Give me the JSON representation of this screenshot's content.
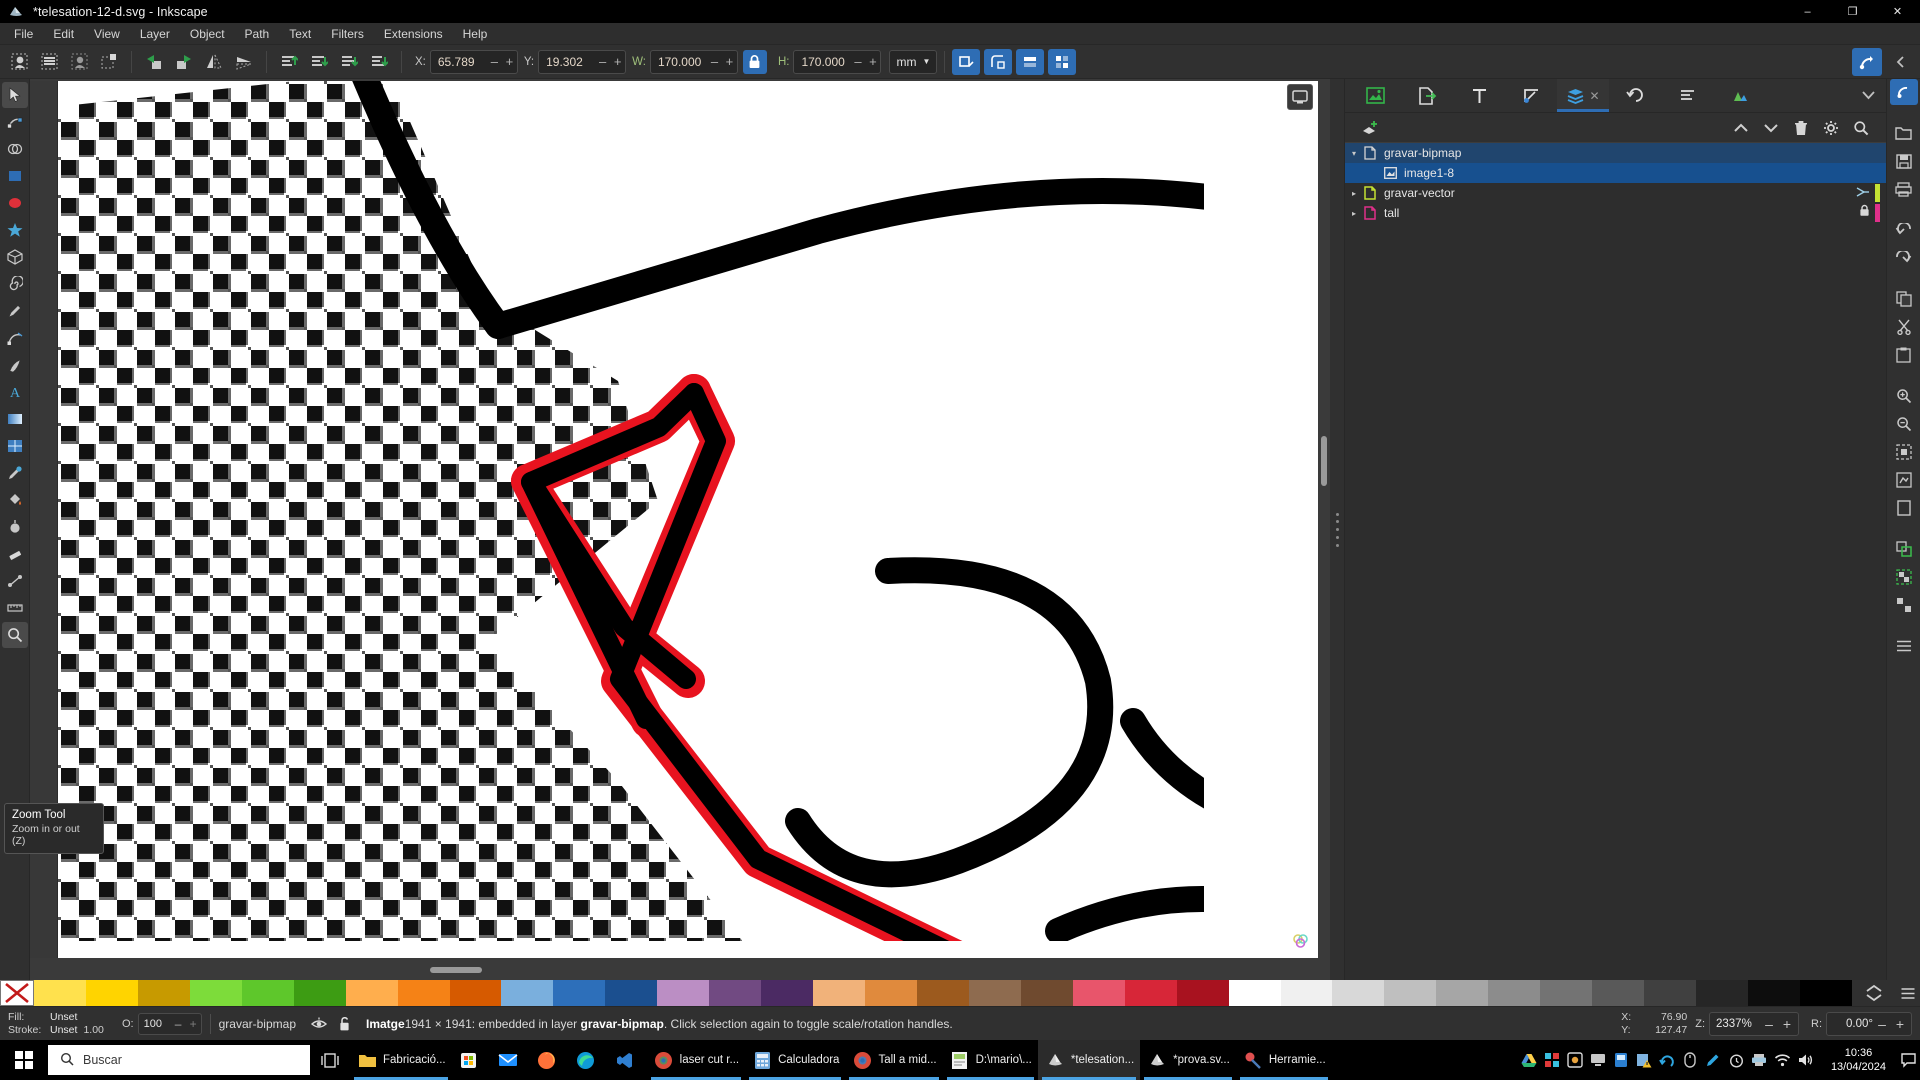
{
  "window": {
    "title": "*telesation-12-d.svg - Inkscape",
    "app_icon": "inkscape-icon",
    "minimize": "–",
    "maximize": "❐",
    "close": "✕"
  },
  "menubar": {
    "items": [
      "File",
      "Edit",
      "View",
      "Layer",
      "Object",
      "Path",
      "Text",
      "Filters",
      "Extensions",
      "Help"
    ]
  },
  "toolcontrols": {
    "select_all_label": "select-all-icon",
    "select_all_layers_label": "select-all-layers-icon",
    "deselect_label": "deselect-icon",
    "rubberband_label": "rubberband-icon",
    "rotate_ccw": "rotate-ccw-icon",
    "rotate_cw": "rotate-cw-icon",
    "flip_h": "flip-horizontal-icon",
    "flip_v": "flip-vertical-icon",
    "raise_top": "raise-to-top-icon",
    "raise": "raise-icon",
    "lower": "lower-icon",
    "lower_bottom": "lower-to-bottom-icon",
    "x_label": "X:",
    "x_value": "65.789",
    "y_label": "Y:",
    "y_value": "19.302",
    "w_label": "W:",
    "w_value": "170.000",
    "lock_icon": "lock-closed-icon",
    "h_label": "H:",
    "h_value": "170.000",
    "units": "mm",
    "minus": "–",
    "plus": "+",
    "affect_stroke": "affect-stroke-icon",
    "affect_corners": "affect-corners-icon",
    "affect_gradients": "affect-gradients-icon",
    "affect_patterns": "affect-patterns-icon",
    "command_overflow": "chevron-left-icon",
    "snap_toggle": "snap-toggle-icon"
  },
  "toolbox": {
    "tools": [
      {
        "name": "selector-tool",
        "active": true
      },
      {
        "name": "node-tool",
        "active": false
      },
      {
        "name": "shape-builder-tool",
        "active": false
      },
      {
        "name": "rectangle-tool",
        "active": false
      },
      {
        "name": "ellipse-tool",
        "active": false
      },
      {
        "name": "star-tool",
        "active": false
      },
      {
        "name": "3dbox-tool",
        "active": false
      },
      {
        "name": "spiral-tool",
        "active": false
      },
      {
        "name": "pencil-tool",
        "active": false
      },
      {
        "name": "bezier-tool",
        "active": false
      },
      {
        "name": "calligraphy-tool",
        "active": false
      },
      {
        "name": "text-tool",
        "active": false
      },
      {
        "name": "gradient-tool",
        "active": false
      },
      {
        "name": "mesh-tool",
        "active": false
      },
      {
        "name": "dropper-tool",
        "active": false
      },
      {
        "name": "paintbucket-tool",
        "active": false
      },
      {
        "name": "tweak-tool",
        "active": false
      },
      {
        "name": "eraser-tool",
        "active": false
      },
      {
        "name": "connector-tool",
        "active": false
      },
      {
        "name": "measure-tool",
        "active": false
      },
      {
        "name": "zoom-tool",
        "active": true
      }
    ]
  },
  "tooltip": {
    "title": "Zoom Tool",
    "subtitle": "Zoom in or out (Z)"
  },
  "dock": {
    "tabs": [
      {
        "name": "tab-image-properties",
        "icon": "image-properties-icon",
        "active": false
      },
      {
        "name": "tab-export",
        "icon": "export-icon",
        "active": false
      },
      {
        "name": "tab-text-and-font",
        "icon": "text-font-icon",
        "active": false
      },
      {
        "name": "tab-fill-and-stroke",
        "icon": "fill-stroke-icon",
        "active": false
      },
      {
        "name": "tab-objects",
        "icon": "objects-layers-icon",
        "active": true
      },
      {
        "name": "tab-undo-history",
        "icon": "undo-history-icon",
        "active": false
      },
      {
        "name": "tab-xml-editor",
        "icon": "xml-editor-icon",
        "active": false
      },
      {
        "name": "tab-layers",
        "icon": "layers-icon",
        "active": false
      }
    ],
    "close_label": "✕",
    "overflow_icon": "chevron-down-icon",
    "toolbar": {
      "new_layer": "add-layer-icon",
      "move_up": "chevron-up-icon",
      "move_down": "chevron-down-icon",
      "delete": "trash-icon",
      "settings": "gear-icon",
      "search": "search-icon"
    },
    "objects": [
      {
        "label": "gravar-bipmap",
        "icon": "layer-page-icon",
        "indent": 0,
        "expander": "▾",
        "selected_parent": true,
        "selected": false,
        "icon_color": "#d5d5d5",
        "badge": "",
        "swatch": ""
      },
      {
        "label": "image1-8",
        "icon": "image-object-icon",
        "indent": 1,
        "expander": "",
        "selected_parent": false,
        "selected": true,
        "icon_color": "#d5d5d5",
        "badge": "",
        "swatch": ""
      },
      {
        "label": "gravar-vector",
        "icon": "layer-page-icon",
        "indent": 0,
        "expander": "▸",
        "selected_parent": false,
        "selected": false,
        "icon_color": "#c4e233",
        "badge": "clip-icon",
        "swatch": "#c4e233"
      },
      {
        "label": "tall",
        "icon": "layer-page-icon",
        "indent": 0,
        "expander": "▸",
        "selected_parent": false,
        "selected": false,
        "icon_color": "#e0308a",
        "badge": "lock-icon",
        "swatch": "#e0308a"
      }
    ]
  },
  "rail": {
    "buttons": [
      {
        "name": "rail-commands-bar-toggle",
        "icon": "toggle-icon"
      },
      {
        "name": "rail-open-icon",
        "icon": "open-icon"
      },
      {
        "name": "rail-save-icon",
        "icon": "save-icon"
      },
      {
        "name": "rail-print-icon",
        "icon": "print-icon"
      },
      {
        "name": "rail-undo-icon",
        "icon": "undo-icon"
      },
      {
        "name": "rail-redo-icon",
        "icon": "redo-icon"
      },
      {
        "name": "rail-copy-icon",
        "icon": "copy-icon"
      },
      {
        "name": "rail-cut-icon",
        "icon": "cut-icon"
      },
      {
        "name": "rail-paste-icon",
        "icon": "paste-icon"
      },
      {
        "name": "rail-zoom-in-icon",
        "icon": "zoom-in-icon"
      },
      {
        "name": "rail-zoom-out-icon",
        "icon": "zoom-out-icon"
      },
      {
        "name": "rail-zoom-selection-icon",
        "icon": "zoom-selection-icon"
      },
      {
        "name": "rail-zoom-drawing-icon",
        "icon": "zoom-drawing-icon"
      },
      {
        "name": "rail-zoom-page-icon",
        "icon": "zoom-page-icon"
      },
      {
        "name": "rail-duplicate-icon",
        "icon": "duplicate-icon"
      },
      {
        "name": "rail-group-icon",
        "icon": "group-icon"
      },
      {
        "name": "rail-ungroup-icon",
        "icon": "ungroup-icon"
      },
      {
        "name": "rail-menu-icon",
        "icon": "hamburger-icon"
      }
    ]
  },
  "palette": {
    "none_label": "X",
    "colors": [
      "#ffe14d",
      "#ffd400",
      "#c79a00",
      "#7ddc3a",
      "#5ec72b",
      "#3d9c13",
      "#ffae4d",
      "#f58216",
      "#d65a00",
      "#7aafdd",
      "#2d6fba",
      "#1b4f8f",
      "#bb8ec4",
      "#714a82",
      "#4b2a63",
      "#f1b27a",
      "#e08a3d",
      "#9c5a1e",
      "#8e6b4f",
      "#6f4a2f",
      "#e8556b",
      "#d72638",
      "#a8121f",
      "#ffffff",
      "#f0f0f0",
      "#d8d8d8",
      "#bfbfbf",
      "#a6a6a6",
      "#8c8c8c",
      "#737373",
      "#595959",
      "#404040",
      "#262626",
      "#0d0d0d",
      "#000000"
    ],
    "scroll_up": "chevron-up-icon",
    "scroll_down": "chevron-down-icon",
    "menu": "hamburger-icon"
  },
  "statusbar": {
    "fill_label": "Fill:",
    "fill_value": "Unset",
    "stroke_label": "Stroke:",
    "stroke_value": "Unset",
    "stroke_width": "1.00",
    "opacity_label": "O:",
    "opacity_value": "100",
    "layer_name": "gravar-bipmap",
    "layer_visibility_icon": "eye-icon",
    "layer_lock_icon": "unlock-icon",
    "selection_prefix": "Imatge",
    "selection_dimensions": "1941 × 1941",
    "selection_mid": ": embedded in layer ",
    "selection_layer": "gravar-bipmap",
    "selection_suffix": ". Click selection again to toggle scale/rotation handles.",
    "x_label": "X:",
    "x_value": "76.90",
    "y_label": "Y:",
    "y_value": "127.47",
    "zoom_label": "Z:",
    "zoom_value": "2337%",
    "rotation_label": "R:",
    "rotation_value": "0.00°",
    "minus": "–",
    "plus": "+"
  },
  "taskbar": {
    "start_icon": "windows-start-icon",
    "search_placeholder": "Buscar",
    "search_icon": "search-icon",
    "taskview_icon": "task-view-icon",
    "apps": [
      {
        "label": "Fabricació...",
        "icon": "folder-icon",
        "icon_color": "#f0c040",
        "running": true,
        "active": false,
        "has_label": true
      },
      {
        "label": "",
        "icon": "microsoft-store-icon",
        "icon_color": "#ffffff",
        "running": false,
        "active": false,
        "has_label": false
      },
      {
        "label": "",
        "icon": "mail-icon",
        "icon_color": "#1e90ff",
        "running": false,
        "active": false,
        "has_label": false
      },
      {
        "label": "",
        "icon": "firefox-icon",
        "icon_color": "#ff7139",
        "running": false,
        "active": false,
        "has_label": false
      },
      {
        "label": "",
        "icon": "edge-icon",
        "icon_color": "#0f9bd7",
        "running": false,
        "active": false,
        "has_label": false
      },
      {
        "label": "",
        "icon": "vscode-icon",
        "icon_color": "#2f7fd1",
        "running": false,
        "active": false,
        "has_label": false
      },
      {
        "label": "laser cut r...",
        "icon": "chrome-icon",
        "icon_color": "#d94b3a",
        "running": true,
        "active": false,
        "has_label": true
      },
      {
        "label": "Calculadora",
        "icon": "calculator-icon",
        "icon_color": "#6fa8dc",
        "running": true,
        "active": false,
        "has_label": true
      },
      {
        "label": "Tall a mid...",
        "icon": "chrome-icon",
        "icon_color": "#d94b3a",
        "running": true,
        "active": false,
        "has_label": true
      },
      {
        "label": "D:\\mario\\...",
        "icon": "explorer-icon",
        "icon_color": "#9ccc65",
        "running": true,
        "active": false,
        "has_label": true
      },
      {
        "label": "*telesation...",
        "icon": "inkscape-icon",
        "icon_color": "#cccccc",
        "running": true,
        "active": true,
        "has_label": true
      },
      {
        "label": "*prova.sv...",
        "icon": "inkscape-icon",
        "icon_color": "#cccccc",
        "running": true,
        "active": false,
        "has_label": true
      },
      {
        "label": "Herramie...",
        "icon": "tools-icon",
        "icon_color": "#e05050",
        "running": true,
        "active": false,
        "has_label": true
      }
    ],
    "tray": [
      {
        "name": "tray-google-drive-icon"
      },
      {
        "name": "tray-utorrent-icon"
      },
      {
        "name": "tray-safe-icon"
      },
      {
        "name": "tray-display-icon"
      },
      {
        "name": "tray-blue-app-icon"
      },
      {
        "name": "tray-warning-icon"
      },
      {
        "name": "tray-sync-icon"
      },
      {
        "name": "tray-mouse-icon"
      },
      {
        "name": "tray-pen-icon"
      },
      {
        "name": "tray-clock-icon"
      },
      {
        "name": "tray-printer-icon"
      },
      {
        "name": "tray-wifi-icon"
      },
      {
        "name": "tray-volume-icon"
      }
    ],
    "time": "10:36",
    "date": "13/04/2024",
    "notification_icon": "notification-icon"
  }
}
